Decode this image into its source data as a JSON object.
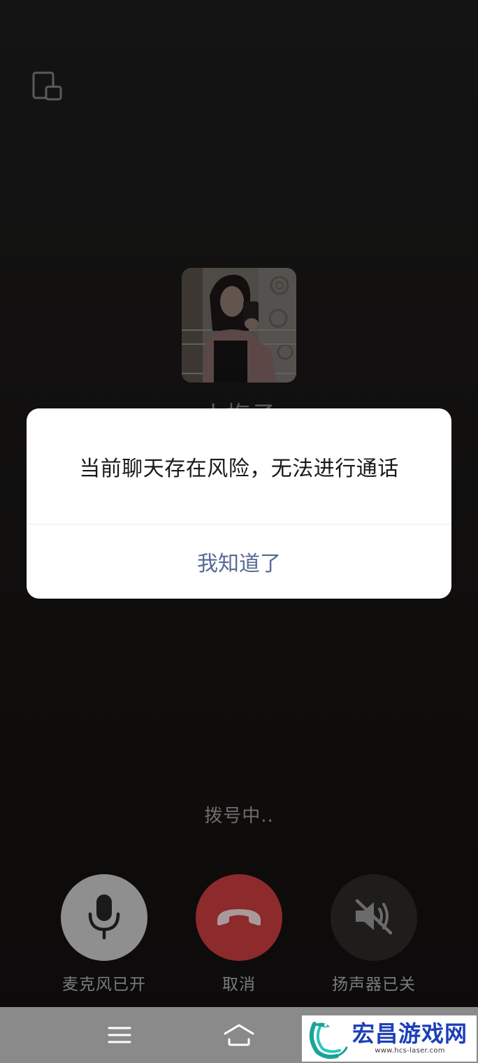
{
  "call": {
    "caller_name": "小梅子",
    "status": "拨号中.."
  },
  "dialog": {
    "message": "当前聊天存在风险，无法进行通话",
    "confirm_label": "我知道了"
  },
  "controls": {
    "mic_label": "麦克风已开",
    "hangup_label": "取消",
    "speaker_label": "扬声器已关"
  },
  "icons": {
    "float": "floating-window-icon",
    "mic": "microphone-icon",
    "hangup": "hang-up-icon",
    "speaker": "speaker-muted-icon",
    "menu": "menu-icon",
    "home": "home-icon"
  },
  "colors": {
    "dialog_button": "#576b95",
    "hangup": "#8c2a2c",
    "mic_on": "#8f8f8f",
    "speaker_off": "#1f1d1c"
  },
  "watermark": {
    "title": "宏昌游戏网",
    "url": "www.hcs-laser.com"
  }
}
